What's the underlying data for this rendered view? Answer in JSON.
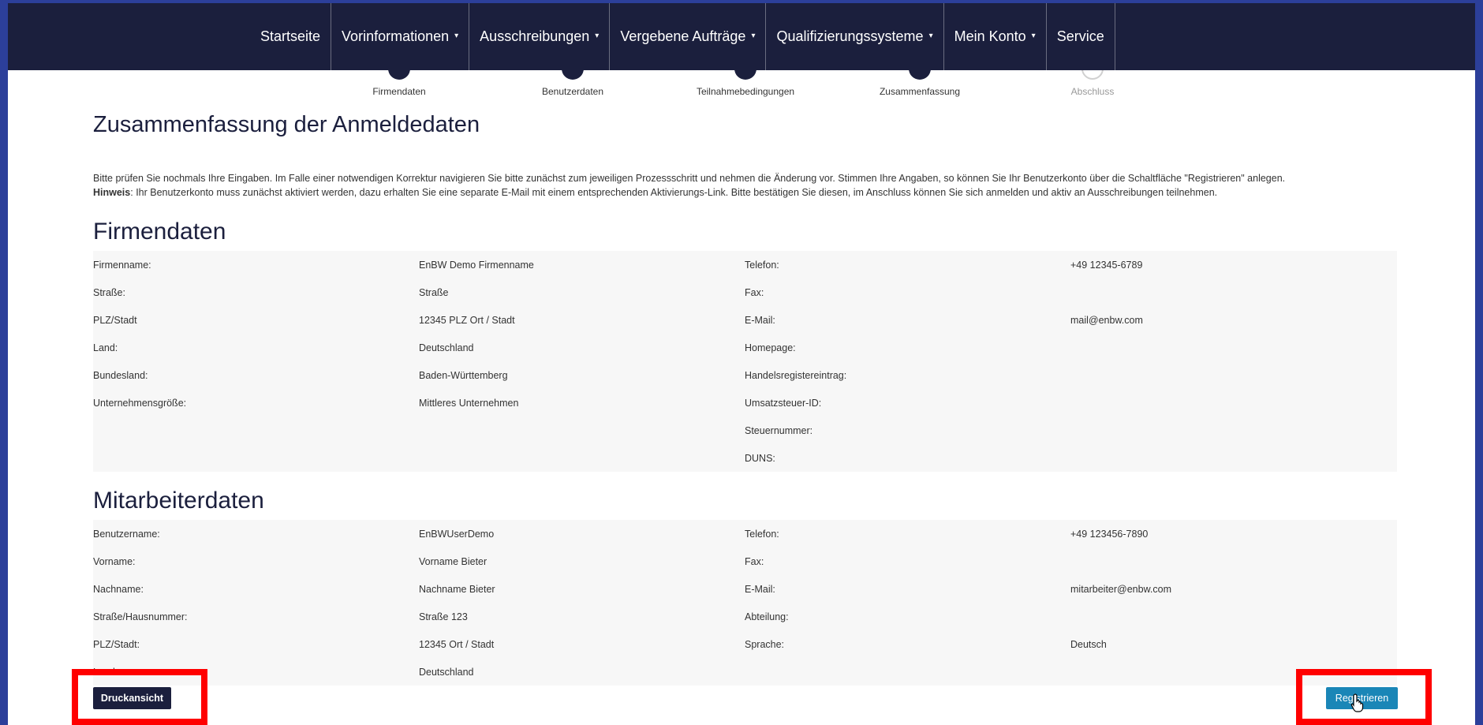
{
  "nav": {
    "items": [
      {
        "label": "Startseite",
        "dropdown": false
      },
      {
        "label": "Vorinformationen",
        "dropdown": true
      },
      {
        "label": "Ausschreibungen",
        "dropdown": true
      },
      {
        "label": "Vergebene Aufträge",
        "dropdown": true
      },
      {
        "label": "Qualifizierungssysteme",
        "dropdown": true
      },
      {
        "label": "Mein Konto",
        "dropdown": true
      },
      {
        "label": "Service",
        "dropdown": false
      }
    ],
    "caret": "▾"
  },
  "steps": [
    {
      "label": "Firmendaten",
      "state": "done"
    },
    {
      "label": "Benutzerdaten",
      "state": "done"
    },
    {
      "label": "Teilnahmebedingungen",
      "state": "done"
    },
    {
      "label": "Zusammenfassung",
      "state": "current"
    },
    {
      "label": "Abschluss",
      "state": "pending"
    }
  ],
  "page_title": "Zusammenfassung der Anmeldedaten",
  "info": {
    "line1": "Bitte prüfen Sie nochmals Ihre Eingaben. Im Falle einer notwendigen Korrektur navigieren Sie bitte zunächst zum jeweiligen Prozessschritt und nehmen die Änderung vor. Stimmen Ihre Angaben, so können Sie Ihr Benutzerkonto über die Schaltfläche \"Registrieren\" anlegen.",
    "hint_label": "Hinweis",
    "hint_text": ": Ihr Benutzerkonto muss zunächst aktiviert werden, dazu erhalten Sie eine separate E-Mail mit einem entsprechenden Aktivierungs-Link. Bitte bestätigen Sie diesen, im Anschluss können Sie sich anmelden und aktiv an Ausschreibungen teilnehmen."
  },
  "firmendaten": {
    "title": "Firmendaten",
    "rows": [
      [
        "Firmenname:",
        "EnBW Demo Firmenname",
        "Telefon:",
        "+49 12345-6789"
      ],
      [
        "Straße:",
        "Straße",
        "Fax:",
        ""
      ],
      [
        "PLZ/Stadt",
        "12345 PLZ Ort / Stadt",
        "E-Mail:",
        "mail@enbw.com"
      ],
      [
        "Land:",
        "Deutschland",
        "Homepage:",
        ""
      ],
      [
        "Bundesland:",
        "Baden-Württemberg",
        "Handelsregistereintrag:",
        ""
      ],
      [
        "Unternehmensgröße:",
        "Mittleres Unternehmen",
        "Umsatzsteuer-ID:",
        ""
      ],
      [
        "",
        "",
        "Steuernummer:",
        ""
      ],
      [
        "",
        "",
        "DUNS:",
        ""
      ]
    ]
  },
  "mitarbeiterdaten": {
    "title": "Mitarbeiterdaten",
    "rows": [
      [
        "Benutzername:",
        "EnBWUserDemo",
        "Telefon:",
        "+49 123456-7890"
      ],
      [
        "Vorname:",
        "Vorname Bieter",
        "Fax:",
        ""
      ],
      [
        "Nachname:",
        "Nachname Bieter",
        "E-Mail:",
        "mitarbeiter@enbw.com"
      ],
      [
        "Straße/Hausnummer:",
        "Straße 123",
        "Abteilung:",
        ""
      ],
      [
        "PLZ/Stadt:",
        "12345 Ort / Stadt",
        "Sprache:",
        "Deutsch"
      ],
      [
        "Land:",
        "Deutschland",
        "",
        ""
      ]
    ]
  },
  "buttons": {
    "print": "Druckansicht",
    "register": "Registrieren"
  },
  "colors": {
    "navbar": "#1b1f3d",
    "accent": "#1a86b7",
    "highlight": "#ff0000",
    "outer_background": "#2c3f9a"
  }
}
